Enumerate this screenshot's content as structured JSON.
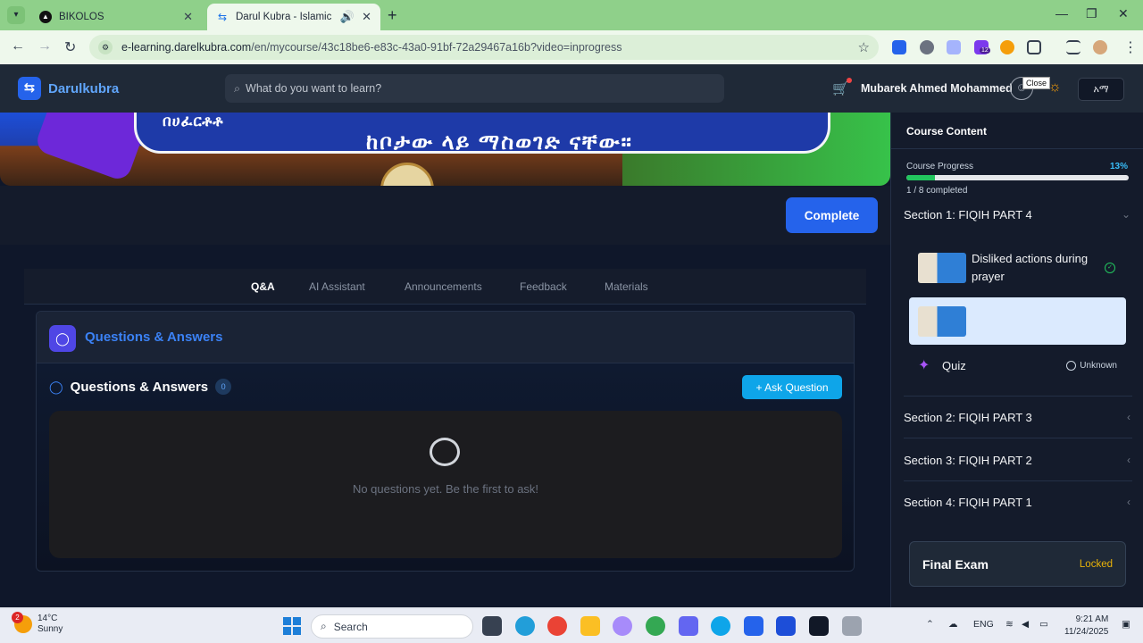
{
  "browser": {
    "tabs": [
      {
        "title": "BIKOLOS",
        "active": false
      },
      {
        "title": "Darul Kubra - Islamic Learni",
        "active": true
      }
    ],
    "url_host": "e-learning.darelkubra.com",
    "url_path": "/en/mycourse/43c18be6-e83c-43a0-91bf-72a29467a16b?video=inprogress",
    "extension_badge": "12"
  },
  "header": {
    "brand": "Darulkubra",
    "search_placeholder": "What do you want to learn?",
    "user_name": "Mubarek Ahmed Mohammed",
    "tooltip": "Close",
    "language": "አማ"
  },
  "video": {
    "caption_line1": "በሀፈርቶቶ",
    "caption_line2": "ከቦታው ላይ ማስወገድ ናቸው።"
  },
  "player": {
    "complete_label": "Complete"
  },
  "tabs": [
    {
      "label": "Q&A",
      "active": true
    },
    {
      "label": "AI Assistant",
      "active": false
    },
    {
      "label": "Announcements",
      "active": false
    },
    {
      "label": "Feedback",
      "active": false
    },
    {
      "label": "Materials",
      "active": false
    }
  ],
  "qa": {
    "panel_title": "Questions & Answers",
    "section_title": "Questions & Answers",
    "count": "0",
    "ask_label": "Ask Question",
    "empty_message": "No questions yet. Be the first to ask!"
  },
  "sidebar": {
    "title": "Course Content",
    "progress_label": "Course Progress",
    "progress_percent": "13%",
    "progress_fraction": 0.13,
    "completed_text": "1 / 8 completed",
    "sections": [
      {
        "title": "Section 1: FIQIH PART 4",
        "expanded": true,
        "lessons": [
          {
            "title": "Disliked actions during prayer",
            "status": "completed"
          },
          {
            "title": "",
            "status": "current"
          }
        ],
        "quiz": {
          "label": "Quiz",
          "status": "Unknown"
        }
      },
      {
        "title": "Section 2: FIQIH PART 3",
        "expanded": false
      },
      {
        "title": "Section 3: FIQIH PART 2",
        "expanded": false
      },
      {
        "title": "Section 4: FIQIH PART 1",
        "expanded": false
      }
    ],
    "final_exam": {
      "label": "Final Exam",
      "status": "Locked"
    }
  },
  "taskbar": {
    "weather_temp": "14°C",
    "weather_desc": "Sunny",
    "weather_badge": "2",
    "search_label": "Search",
    "language": "ENG",
    "time": "9:21 AM",
    "date": "11/24/2025"
  }
}
